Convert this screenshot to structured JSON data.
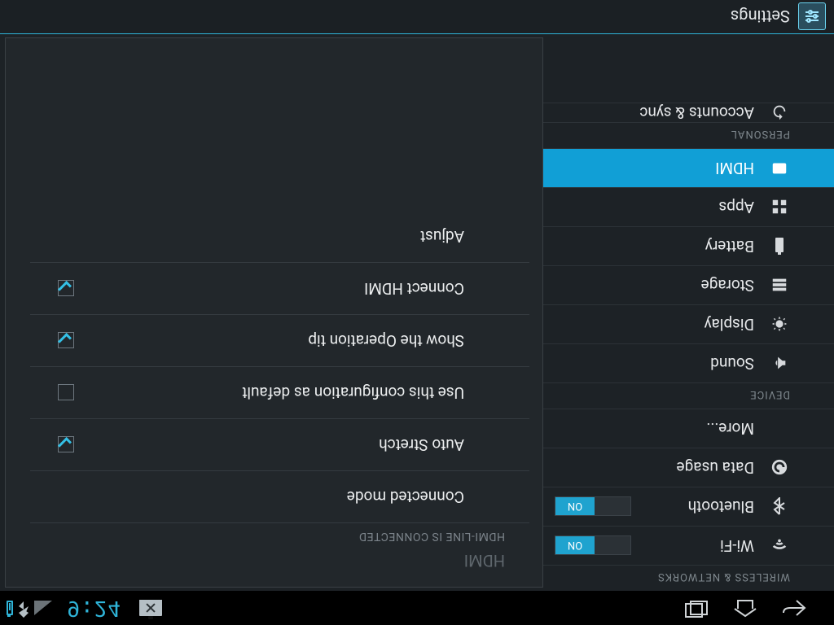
{
  "statusbar": {
    "time": "9:24"
  },
  "sysbar": {
    "app_label": "Settings"
  },
  "sidebar": {
    "cat_wireless": "WIRELESS & NETWORKS",
    "wifi": "Wi-Fi",
    "bluetooth": "Bluetooth",
    "data_usage": "Data usage",
    "more": "More...",
    "toggle_on": "ON",
    "cat_device": "DEVICE",
    "sound": "Sound",
    "display": "Display",
    "storage": "Storage",
    "battery": "Battery",
    "apps": "Apps",
    "hdmi": "HDMI",
    "cat_personal": "PERSONAL",
    "accounts": "Accounts & sync"
  },
  "pane": {
    "title": "HDMI",
    "subtitle": "HDMI-LINE IS CONNECTED",
    "connected_mode": "Connected mode",
    "auto_stretch": "Auto Stretch",
    "use_default": "Use this configuration as default",
    "show_tip": "Show the Operation tip",
    "connect_hdmi": "Connect HDMI",
    "adjust": "Adjust"
  },
  "checks": {
    "auto_stretch": true,
    "use_default": false,
    "show_tip": true,
    "connect_hdmi": true
  }
}
